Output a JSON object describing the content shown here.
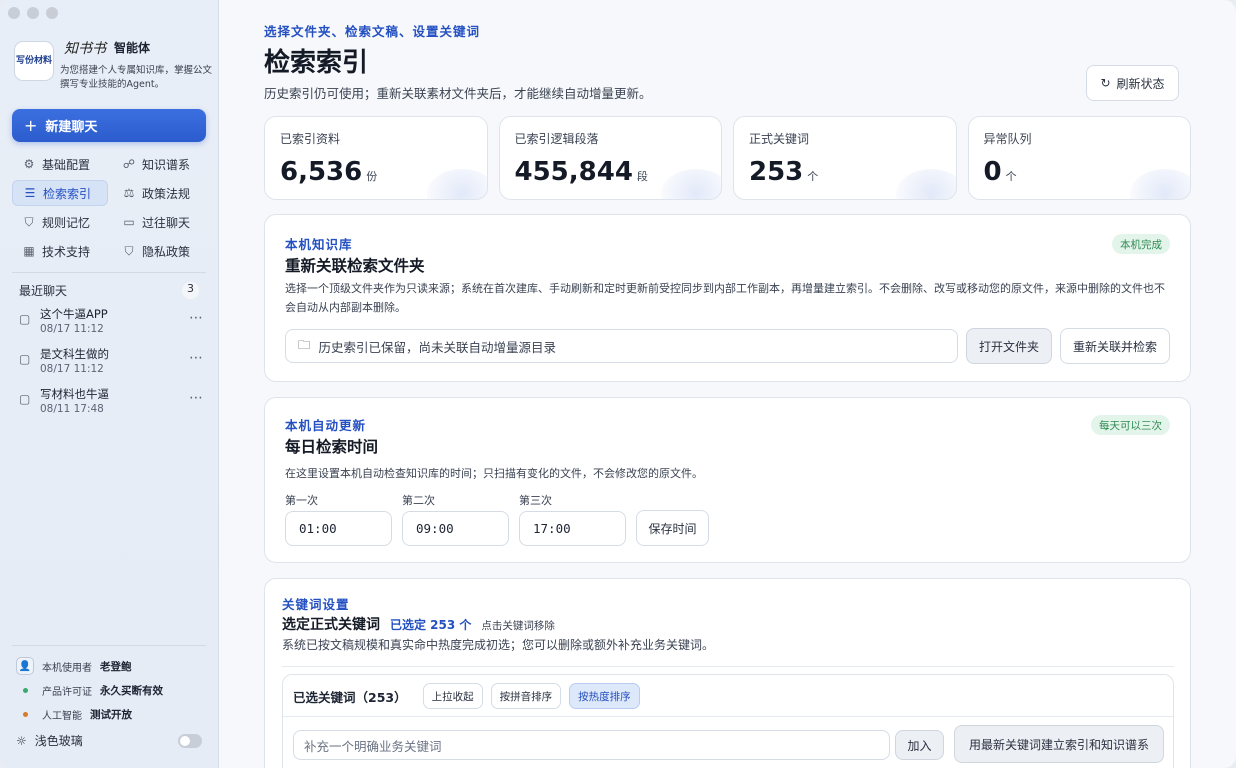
{
  "sidebar": {
    "brand": {
      "logo_text": "写份材料",
      "script": "知书书",
      "name": "智能体",
      "desc": "为您搭建个人专属知识库，掌握公文撰写专业技能的Agent。"
    },
    "new_chat": "新建聊天",
    "nav": [
      {
        "label": "基础配置",
        "icon": "gear-icon",
        "glyph": "⚙"
      },
      {
        "label": "知识谱系",
        "icon": "graph-icon",
        "glyph": "☍"
      },
      {
        "label": "检索索引",
        "icon": "list-icon",
        "glyph": "☰",
        "active": true
      },
      {
        "label": "政策法规",
        "icon": "scale-icon",
        "glyph": "⚖"
      },
      {
        "label": "规则记忆",
        "icon": "shield-icon",
        "glyph": "⛉"
      },
      {
        "label": "过往聊天",
        "icon": "chat-icon",
        "glyph": "▭"
      },
      {
        "label": "技术支持",
        "icon": "building-icon",
        "glyph": "▦"
      },
      {
        "label": "隐私政策",
        "icon": "shield-icon",
        "glyph": "⛉"
      }
    ],
    "recent": {
      "title": "最近聊天",
      "count": "3",
      "items": [
        {
          "title": "这个牛逼APP",
          "date": "08/17 11:12"
        },
        {
          "title": "是文科生做的",
          "date": "08/17 11:12"
        },
        {
          "title": "写材料也牛逼",
          "date": "08/11 17:48"
        }
      ]
    },
    "footer": {
      "user_label": "本机使用者",
      "user_value": "老登鲍",
      "license_label": "产品许可证",
      "license_value": "永久买断有效",
      "ai_label": "人工智能",
      "ai_value": "测试开放",
      "license_color": "#3ba86b",
      "ai_color": "#d77b2c"
    },
    "theme_label": "浅色玻璃"
  },
  "header": {
    "crumb": "选择文件夹、检索文稿、设置关键词",
    "title": "检索索引",
    "subtitle": "历史索引仍可使用；重新关联素材文件夹后，才能继续自动增量更新。",
    "refresh": "刷新状态"
  },
  "stats": [
    {
      "label": "已索引资料",
      "value": "6,536",
      "unit": "份"
    },
    {
      "label": "已索引逻辑段落",
      "value": "455,844",
      "unit": "段"
    },
    {
      "label": "正式关键词",
      "value": "253",
      "unit": "个"
    },
    {
      "label": "异常队列",
      "value": "0",
      "unit": "个"
    }
  ],
  "local_kb": {
    "eyebrow": "本机知识库",
    "title": "重新关联检索文件夹",
    "badge": "本机完成",
    "desc": "选择一个顶级文件夹作为只读来源；系统在首次建库、手动刷新和定时更新前受控同步到内部工作副本，再增量建立索引。不会删除、改写或移动您的原文件，来源中删除的文件也不会自动从内部副本删除。",
    "path_placeholder": "历史索引已保留，尚未关联自动增量源目录",
    "open_folder": "打开文件夹",
    "relink": "重新关联并检索"
  },
  "auto_update": {
    "eyebrow": "本机自动更新",
    "title": "每日检索时间",
    "badge": "每天可以三次",
    "desc": "在这里设置本机自动检查知识库的时间；只扫描有变化的文件，不会修改您的原文件。",
    "times": [
      {
        "label": "第一次",
        "value": "01:00"
      },
      {
        "label": "第二次",
        "value": "09:00"
      },
      {
        "label": "第三次",
        "value": "17:00"
      }
    ],
    "save": "保存时间"
  },
  "keywords": {
    "eyebrow": "关键词设置",
    "title": "选定正式关键词",
    "selected": "已选定 253 个",
    "hint": "点击关键词移除",
    "desc": "系统已按文稿规模和真实命中热度完成初选；您可以删除或额外补充业务关键词。",
    "box_title": "已选关键词（253）",
    "chips": [
      "上拉收起",
      "按拼音排序",
      "按热度排序"
    ],
    "input_placeholder": "补充一个明确业务关键词",
    "add": "加入",
    "rebuild": "用最新关键词建立索引和知识谱系"
  }
}
